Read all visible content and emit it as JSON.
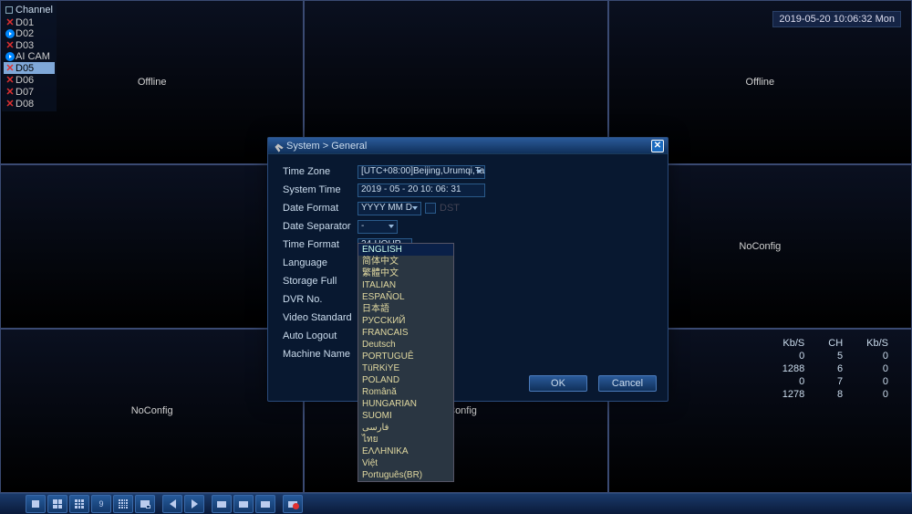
{
  "datetime": "2019-05-20 10:06:32 Mon",
  "sidebar": {
    "title": "Channel",
    "items": [
      {
        "label": "D01",
        "state": "x"
      },
      {
        "label": "D02",
        "state": "play"
      },
      {
        "label": "D03",
        "state": "x"
      },
      {
        "label": "AI CAM",
        "state": "play"
      },
      {
        "label": "D05",
        "state": "x",
        "selected": true
      },
      {
        "label": "D06",
        "state": "x"
      },
      {
        "label": "D07",
        "state": "x"
      },
      {
        "label": "D08",
        "state": "x"
      }
    ]
  },
  "cells": [
    {
      "text": "Offline"
    },
    {
      "text": ""
    },
    {
      "text": "Offline"
    },
    {
      "text": ""
    },
    {
      "text": ""
    },
    {
      "text": "NoConfig"
    },
    {
      "text": "NoConfig"
    },
    {
      "text": "NoConfig"
    },
    {
      "text": ""
    }
  ],
  "stats": {
    "headers": [
      "Kb/S",
      "CH",
      "Kb/S"
    ],
    "rows": [
      [
        "0",
        "5",
        "0"
      ],
      [
        "1288",
        "6",
        "0"
      ],
      [
        "0",
        "7",
        "0"
      ],
      [
        "1278",
        "8",
        "0"
      ]
    ]
  },
  "dialog": {
    "title": "System > General",
    "labels": {
      "timezone": "Time Zone",
      "systime": "System Time",
      "dateformat": "Date Format",
      "datesep": "Date Separator",
      "timeformat": "Time Format",
      "language": "Language",
      "storagefull": "Storage Full",
      "dvrno": "DVR No.",
      "videostd": "Video Standard",
      "autologout": "Auto Logout",
      "machinename": "Machine Name"
    },
    "values": {
      "timezone": "[UTC+08:00]Beijing,Urumqi,Ta",
      "systime": "2019 - 05 - 20  10: 06: 31",
      "dateformat": "YYYY MM D",
      "datesep": "-",
      "timeformat": "24-HOUR",
      "language": "ENGLISH",
      "dst": "DST"
    },
    "buttons": {
      "ok": "OK",
      "cancel": "Cancel"
    },
    "language_options": [
      "ENGLISH",
      "简体中文",
      "繁體中文",
      "ITALIAN",
      "ESPAÑOL",
      "日本語",
      "РУССКИЙ",
      "FRANCAIS",
      "Deutsch",
      "PORTUGUÊ",
      "TüRKiYE",
      "POLAND",
      "Română",
      "HUNGARIAN",
      "SUOMI",
      "فارسی",
      "ไทย",
      "ΕΛΛΗΝΙΚΑ",
      "Việt",
      "Português(BR)"
    ]
  },
  "toolbar": [
    "layout-1",
    "layout-4",
    "layout-9",
    "layout-9b",
    "layout-16",
    "pip",
    "prev",
    "next",
    "screen-a",
    "screen-b",
    "screen-c",
    "record"
  ]
}
